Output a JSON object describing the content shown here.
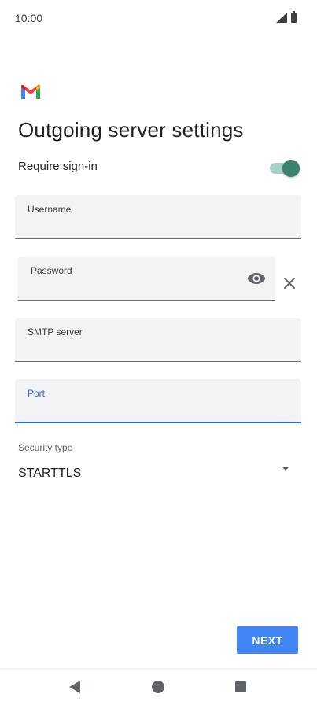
{
  "status_bar": {
    "time": "10:00"
  },
  "header": {
    "title": "Outgoing server settings"
  },
  "require_signin": {
    "label": "Require sign-in",
    "enabled": true,
    "accent_color": "#3b8272"
  },
  "fields": {
    "username": {
      "label": "Username",
      "value": ""
    },
    "password": {
      "label": "Password",
      "value": ""
    },
    "smtp_server": {
      "label": "SMTP server",
      "value": ""
    },
    "port": {
      "label": "Port",
      "value": ""
    }
  },
  "security": {
    "label": "Security type",
    "value": "STARTTLS"
  },
  "actions": {
    "next_label": "NEXT",
    "next_color": "#4285f4"
  },
  "icons": {
    "logo": "gmail-logo-icon",
    "visibility": "eye-icon",
    "clear": "close-icon",
    "dropdown": "dropdown-arrow-icon"
  }
}
